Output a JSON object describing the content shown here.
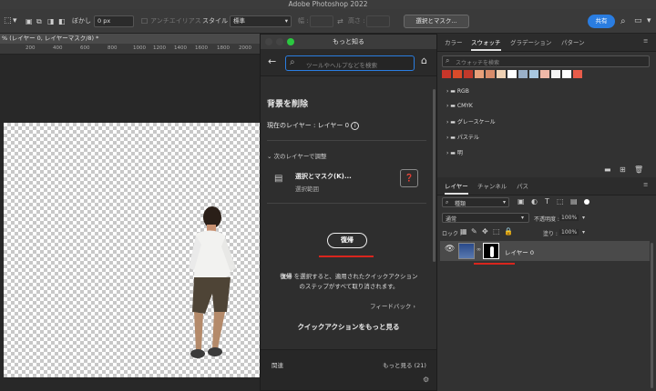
{
  "app": {
    "title": "Adobe Photoshop 2022"
  },
  "options": {
    "feather_label": "ぼかし :",
    "feather_value": "0 px",
    "antialias_label": "アンチエイリアス",
    "style_label": "スタイル :",
    "style_value": "標準",
    "width_label": "幅 :",
    "height_label": "高さ :",
    "select_mask_label": "選択とマスク...",
    "share_label": "共有"
  },
  "document": {
    "tab_label": "% (レイヤー 0, レイヤーマスク/8) *",
    "ruler": [
      "200",
      "400",
      "600",
      "800",
      "1000",
      "1200",
      "1400",
      "1600",
      "1800",
      "2000"
    ]
  },
  "dialog": {
    "title": "もっと知る",
    "search_placeholder": "ツールやヘルプなどを検索",
    "heading": "背景を削除",
    "current_layer": "現在のレイヤー : レイヤー 0",
    "next_label": "次のレイヤーで調整",
    "action_title": "選択とマスク(K)...",
    "action_sub": "選択範囲",
    "restore_label": "復帰",
    "desc_bold": "復帰",
    "desc_rest": " を選択すると、適用されたクイックアクション",
    "desc_line2": "のステップがすべて取り消されます。",
    "feedback": "フィードバック ›",
    "more_actions": "クイックアクションをもっと見る",
    "related": "関連",
    "more_count": "もっと見る (21)"
  },
  "swatches_panel": {
    "tabs": [
      "カラー",
      "スウォッチ",
      "グラデーション",
      "パターン"
    ],
    "search_placeholder": "スウォッチを検索",
    "colors": [
      "#c8362a",
      "#d94b2a",
      "#c0392b",
      "#e8a07a",
      "#d98c6a",
      "#f0d2b4",
      "#ffffff",
      "#9ab0c8",
      "#a8c8e0",
      "#f0b8a8",
      "#f5f5f5",
      "#ffffff",
      "#e85c4a"
    ],
    "folders": [
      "RGB",
      "CMYK",
      "グレースケール",
      "パステル",
      "明"
    ]
  },
  "layers_panel": {
    "tabs": [
      "レイヤー",
      "チャンネル",
      "パス"
    ],
    "kind_value": "種類",
    "blend_value": "通常",
    "opacity_label": "不透明度 :",
    "opacity_value": "100%",
    "lock_label": "ロック :",
    "fill_label": "塗り :",
    "fill_value": "100%",
    "layer_name": "レイヤー 0"
  },
  "accent": {
    "blue": "#2a7de1",
    "red": "#d9251d"
  }
}
